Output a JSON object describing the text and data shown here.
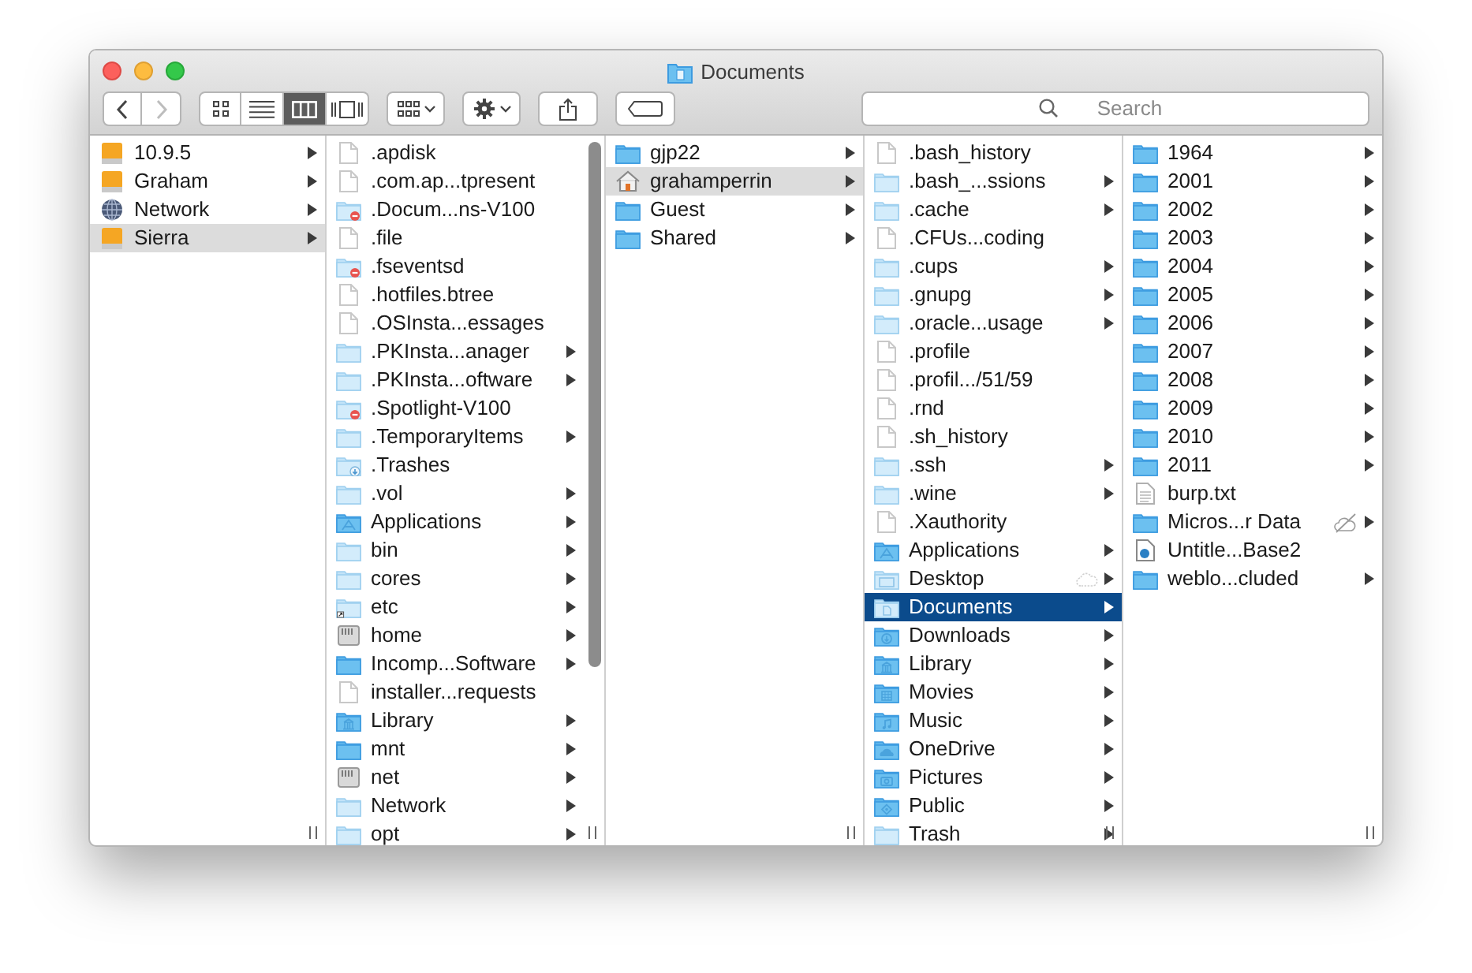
{
  "window": {
    "title": "Documents"
  },
  "toolbar": {
    "back": {
      "disabled": false
    },
    "forward": {
      "disabled": true
    },
    "view_modes": [
      {
        "kind": "icons",
        "selected": false
      },
      {
        "kind": "list",
        "selected": false
      },
      {
        "kind": "columns",
        "selected": true
      },
      {
        "kind": "coverflow",
        "selected": false
      }
    ],
    "search": {
      "placeholder": "Search"
    }
  },
  "columns": [
    {
      "active": false,
      "scrollbar": false,
      "items": [
        {
          "name": "10.9.5",
          "kind": "drive",
          "expandable": true,
          "selected": false
        },
        {
          "name": "Graham",
          "kind": "drive",
          "expandable": true,
          "selected": false
        },
        {
          "name": "Network",
          "kind": "globe",
          "expandable": true,
          "selected": false
        },
        {
          "name": "Sierra",
          "kind": "drive",
          "expandable": true,
          "selected": true
        }
      ]
    },
    {
      "scrollbar": true,
      "items": [
        {
          "name": ".apdisk",
          "kind": "file",
          "expandable": false,
          "selected": false
        },
        {
          "name": ".com.ap...tpresent",
          "kind": "file",
          "expandable": false,
          "selected": false
        },
        {
          "name": ".Docum...ns-V100",
          "kind": "folder-restricted",
          "expandable": false,
          "selected": false
        },
        {
          "name": ".file",
          "kind": "file",
          "expandable": false,
          "selected": false
        },
        {
          "name": ".fseventsd",
          "kind": "folder-restricted",
          "expandable": false,
          "selected": false
        },
        {
          "name": ".hotfiles.btree",
          "kind": "file",
          "expandable": false,
          "selected": false
        },
        {
          "name": ".OSInsta...essages",
          "kind": "file",
          "expandable": false,
          "selected": false
        },
        {
          "name": ".PKInsta...anager",
          "kind": "folder-pale",
          "expandable": true,
          "selected": false
        },
        {
          "name": ".PKInsta...oftware",
          "kind": "folder-pale",
          "expandable": true,
          "selected": false
        },
        {
          "name": ".Spotlight-V100",
          "kind": "folder-restricted",
          "expandable": false,
          "selected": false
        },
        {
          "name": ".TemporaryItems",
          "kind": "folder-pale",
          "expandable": true,
          "selected": false
        },
        {
          "name": ".Trashes",
          "kind": "folder-trash",
          "expandable": false,
          "selected": false
        },
        {
          "name": ".vol",
          "kind": "folder-pale",
          "expandable": true,
          "selected": false
        },
        {
          "name": "Applications",
          "kind": "folder-apps",
          "expandable": true,
          "selected": false
        },
        {
          "name": "bin",
          "kind": "folder-pale",
          "expandable": true,
          "selected": false
        },
        {
          "name": "cores",
          "kind": "folder-pale",
          "expandable": true,
          "selected": false
        },
        {
          "name": "etc",
          "kind": "folder-alias",
          "expandable": true,
          "selected": false
        },
        {
          "name": "home",
          "kind": "server",
          "expandable": true,
          "selected": false
        },
        {
          "name": "Incomp...Software",
          "kind": "folder",
          "expandable": true,
          "selected": false
        },
        {
          "name": "installer...requests",
          "kind": "file",
          "expandable": false,
          "selected": false
        },
        {
          "name": "Library",
          "kind": "folder-library",
          "expandable": true,
          "selected": false
        },
        {
          "name": "mnt",
          "kind": "folder",
          "expandable": true,
          "selected": false
        },
        {
          "name": "net",
          "kind": "server",
          "expandable": true,
          "selected": false
        },
        {
          "name": "Network",
          "kind": "folder-pale",
          "expandable": true,
          "selected": false
        },
        {
          "name": "opt",
          "kind": "folder-pale",
          "expandable": true,
          "selected": false
        }
      ]
    },
    {
      "active": false,
      "scrollbar": false,
      "items": [
        {
          "name": "gjp22",
          "kind": "folder",
          "expandable": true,
          "selected": false
        },
        {
          "name": "grahamperrin",
          "kind": "home",
          "expandable": true,
          "selected": true
        },
        {
          "name": "Guest",
          "kind": "folder",
          "expandable": true,
          "selected": false
        },
        {
          "name": "Shared",
          "kind": "folder",
          "expandable": true,
          "selected": false
        }
      ]
    },
    {
      "active": true,
      "scrollbar": false,
      "items": [
        {
          "name": ".bash_history",
          "kind": "file",
          "expandable": false,
          "selected": false
        },
        {
          "name": ".bash_...ssions",
          "kind": "folder-pale",
          "expandable": true,
          "selected": false
        },
        {
          "name": ".cache",
          "kind": "folder-pale",
          "expandable": true,
          "selected": false
        },
        {
          "name": ".CFUs...coding",
          "kind": "file",
          "expandable": false,
          "selected": false
        },
        {
          "name": ".cups",
          "kind": "folder-pale",
          "expandable": true,
          "selected": false
        },
        {
          "name": ".gnupg",
          "kind": "folder-pale",
          "expandable": true,
          "selected": false
        },
        {
          "name": ".oracle...usage",
          "kind": "folder-pale",
          "expandable": true,
          "selected": false
        },
        {
          "name": ".profile",
          "kind": "file",
          "expandable": false,
          "selected": false
        },
        {
          "name": ".profil.../51/59",
          "kind": "file",
          "expandable": false,
          "selected": false
        },
        {
          "name": ".rnd",
          "kind": "file",
          "expandable": false,
          "selected": false
        },
        {
          "name": ".sh_history",
          "kind": "file",
          "expandable": false,
          "selected": false
        },
        {
          "name": ".ssh",
          "kind": "folder-pale",
          "expandable": true,
          "selected": false
        },
        {
          "name": ".wine",
          "kind": "folder-pale",
          "expandable": true,
          "selected": false
        },
        {
          "name": ".Xauthority",
          "kind": "file",
          "expandable": false,
          "selected": false
        },
        {
          "name": "Applications",
          "kind": "folder-apps",
          "expandable": true,
          "selected": false
        },
        {
          "name": "Desktop",
          "kind": "folder-desktop",
          "expandable": true,
          "selected": false,
          "badge": {
            "kind": "cloud"
          }
        },
        {
          "name": "Documents",
          "kind": "folder-documents",
          "expandable": true,
          "selected": true
        },
        {
          "name": "Downloads",
          "kind": "folder-downloads",
          "expandable": true,
          "selected": false
        },
        {
          "name": "Library",
          "kind": "folder-library",
          "expandable": true,
          "selected": false
        },
        {
          "name": "Movies",
          "kind": "folder-movies",
          "expandable": true,
          "selected": false
        },
        {
          "name": "Music",
          "kind": "folder-music",
          "expandable": true,
          "selected": false
        },
        {
          "name": "OneDrive",
          "kind": "folder-onedrive",
          "expandable": true,
          "selected": false
        },
        {
          "name": "Pictures",
          "kind": "folder-pictures",
          "expandable": true,
          "selected": false
        },
        {
          "name": "Public",
          "kind": "folder-public",
          "expandable": true,
          "selected": false
        },
        {
          "name": "Trash",
          "kind": "folder-pale",
          "expandable": true,
          "selected": false
        }
      ]
    },
    {
      "scrollbar": false,
      "items": [
        {
          "name": "1964",
          "kind": "folder",
          "expandable": true,
          "selected": false
        },
        {
          "name": "2001",
          "kind": "folder",
          "expandable": true,
          "selected": false
        },
        {
          "name": "2002",
          "kind": "folder",
          "expandable": true,
          "selected": false
        },
        {
          "name": "2003",
          "kind": "folder",
          "expandable": true,
          "selected": false
        },
        {
          "name": "2004",
          "kind": "folder",
          "expandable": true,
          "selected": false
        },
        {
          "name": "2005",
          "kind": "folder",
          "expandable": true,
          "selected": false
        },
        {
          "name": "2006",
          "kind": "folder",
          "expandable": true,
          "selected": false
        },
        {
          "name": "2007",
          "kind": "folder",
          "expandable": true,
          "selected": false
        },
        {
          "name": "2008",
          "kind": "folder",
          "expandable": true,
          "selected": false
        },
        {
          "name": "2009",
          "kind": "folder",
          "expandable": true,
          "selected": false
        },
        {
          "name": "2010",
          "kind": "folder",
          "expandable": true,
          "selected": false
        },
        {
          "name": "2011",
          "kind": "folder",
          "expandable": true,
          "selected": false
        },
        {
          "name": "burp.txt",
          "kind": "textfile",
          "expandable": false,
          "selected": false
        },
        {
          "name": "Micros...r Data",
          "kind": "folder",
          "expandable": true,
          "selected": false,
          "badge": {
            "kind": "cloud-excluded"
          }
        },
        {
          "name": "Untitle...Base2",
          "kind": "dbfile",
          "expandable": false,
          "selected": false
        },
        {
          "name": "weblo...cluded",
          "kind": "folder",
          "expandable": true,
          "selected": false
        }
      ]
    }
  ]
}
